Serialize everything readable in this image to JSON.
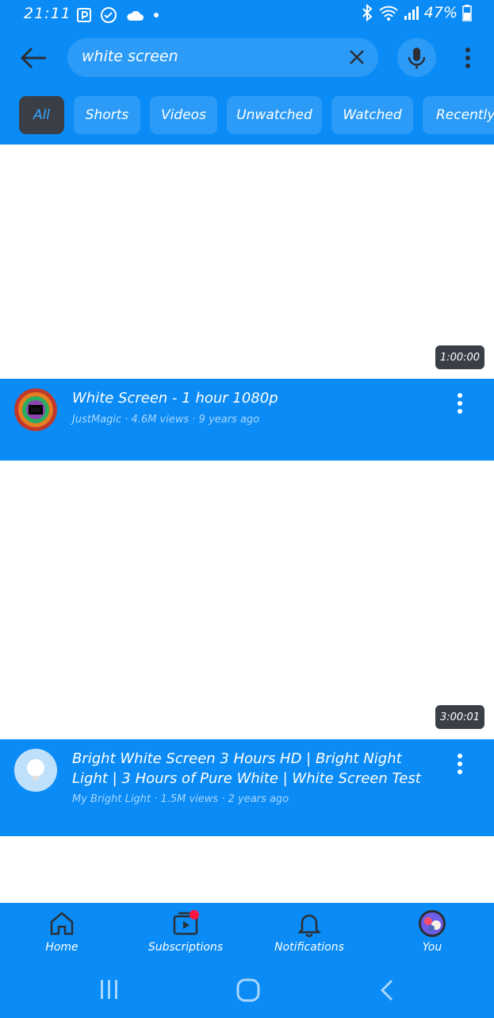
{
  "status_bar": {
    "time": "21:11",
    "battery": "47%"
  },
  "search": {
    "query": "white screen"
  },
  "chips": [
    {
      "label": "All",
      "active": true
    },
    {
      "label": "Shorts",
      "active": false
    },
    {
      "label": "Videos",
      "active": false
    },
    {
      "label": "Unwatched",
      "active": false
    },
    {
      "label": "Watched",
      "active": false
    },
    {
      "label": "Recently uploaded",
      "active": false
    }
  ],
  "videos": [
    {
      "duration": "1:00:00",
      "title": "White Screen - 1 hour 1080p",
      "meta": "JustMagic · 4.6M views · 9 years ago"
    },
    {
      "duration": "3:00:01",
      "title": "Bright White Screen 3 Hours HD | Bright Night Light | 3 Hours of Pure White | White Screen Test",
      "meta": "My Bright Light · 1.5M views · 2 years ago"
    }
  ],
  "bottom_nav": [
    {
      "label": "Home",
      "icon": "home-icon"
    },
    {
      "label": "Subscriptions",
      "icon": "subscriptions-icon"
    },
    {
      "label": "Notifications",
      "icon": "bell-icon"
    },
    {
      "label": "You",
      "icon": "profile-avatar"
    }
  ],
  "colors": {
    "primary_blue": "#0a8bf5",
    "chip_blue": "#2b9bf7",
    "active_chip": "#3a3f47",
    "badge_red": "#ff1744"
  }
}
